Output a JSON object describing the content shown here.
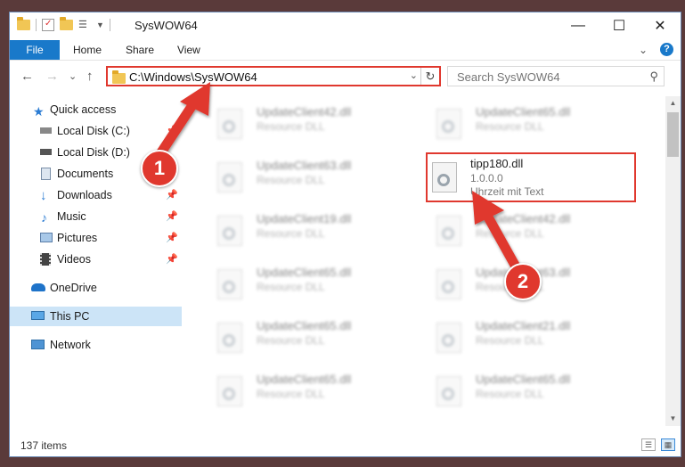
{
  "window": {
    "title": "SysWOW64",
    "controls": {
      "minimize": "—",
      "maximize": "☐",
      "close": "✕"
    }
  },
  "ribbon": {
    "tabs": [
      "File",
      "Home",
      "Share",
      "View"
    ],
    "help": "?",
    "expand": "⌄"
  },
  "nav": {
    "back": "←",
    "forward": "→",
    "recent": "⌄",
    "up": "↑",
    "address": "C:\\Windows\\SysWOW64",
    "address_dropdown": "⌄",
    "refresh": "↻",
    "search_placeholder": "Search SysWOW64"
  },
  "sidebar": {
    "items": [
      {
        "label": "Quick access",
        "icon": "star-icon"
      },
      {
        "label": "Local Disk (C:)",
        "icon": "drive-icon"
      },
      {
        "label": "Local Disk (D:)",
        "icon": "drive-icon"
      },
      {
        "label": "Documents",
        "icon": "documents-icon"
      },
      {
        "label": "Downloads",
        "icon": "downloads-icon"
      },
      {
        "label": "Music",
        "icon": "music-icon"
      },
      {
        "label": "Pictures",
        "icon": "pictures-icon"
      },
      {
        "label": "Videos",
        "icon": "videos-icon"
      },
      {
        "label": "OneDrive",
        "icon": "cloud-icon"
      },
      {
        "label": "This PC",
        "icon": "computer-icon"
      },
      {
        "label": "Network",
        "icon": "network-icon"
      }
    ]
  },
  "files": {
    "left": [
      {
        "name": "UpdateClient42.dll",
        "type": "Resource DLL"
      },
      {
        "name": "UpdateClient63.dll",
        "type": "Resource DLL"
      },
      {
        "name": "UpdateClient19.dll",
        "type": "Resource DLL"
      },
      {
        "name": "UpdateClient65.dll",
        "type": "Resource DLL"
      },
      {
        "name": "UpdateClient65.dll",
        "type": "Resource DLL"
      },
      {
        "name": "UpdateClient65.dll",
        "type": "Resource DLL"
      }
    ],
    "right": [
      {
        "name": "UpdateClient65.dll",
        "type": "Resource DLL"
      },
      {
        "name": "UpdateClient42.dll",
        "type": "Resource DLL"
      },
      {
        "name": "UpdateClient63.dll",
        "type": "Resource DLL"
      },
      {
        "name": "UpdateClient21.dll",
        "type": "Resource DLL"
      },
      {
        "name": "UpdateClient65.dll",
        "type": "Resource DLL"
      }
    ],
    "highlighted": {
      "name": "tipp180.dll",
      "version": "1.0.0.0",
      "description": "Uhrzeit mit Text"
    }
  },
  "status": {
    "count": "137 items"
  },
  "annotations": {
    "step1": "1",
    "step2": "2"
  },
  "colors": {
    "accent": "#1979ca",
    "highlight_red": "#e0382e"
  }
}
